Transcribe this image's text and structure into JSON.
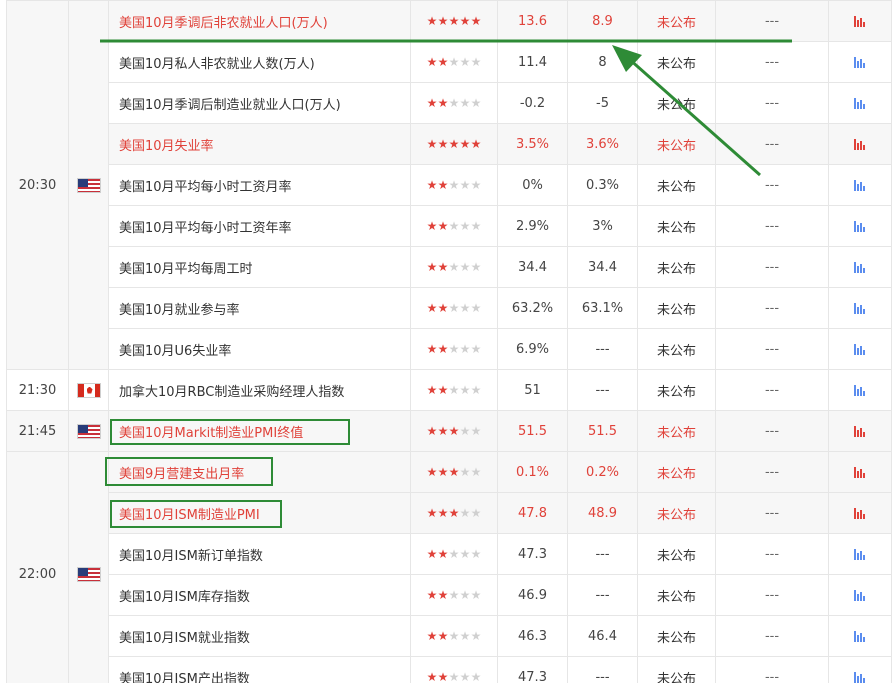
{
  "annotation_color": "#2e8b36",
  "accent_red": "#e0423a",
  "groups": [
    {
      "time": "20:30",
      "flag": "us-flag-icon",
      "rows": [
        {
          "name": "美国10月季调后非农就业人口(万人)",
          "stars": 5,
          "prev": "13.6",
          "forecast": "8.9",
          "actual": "未公布",
          "impact": "---",
          "important": true,
          "chart": "red"
        },
        {
          "name": "美国10月私人非农就业人数(万人)",
          "stars": 2,
          "prev": "11.4",
          "forecast": "8",
          "actual": "未公布",
          "impact": "---",
          "important": false,
          "chart": "blue"
        },
        {
          "name": "美国10月季调后制造业就业人口(万人)",
          "stars": 2,
          "prev": "-0.2",
          "forecast": "-5",
          "actual": "未公布",
          "impact": "---",
          "important": false,
          "chart": "blue"
        },
        {
          "name": "美国10月失业率",
          "stars": 5,
          "prev": "3.5%",
          "forecast": "3.6%",
          "actual": "未公布",
          "impact": "---",
          "important": true,
          "chart": "red"
        },
        {
          "name": "美国10月平均每小时工资月率",
          "stars": 2,
          "prev": "0%",
          "forecast": "0.3%",
          "actual": "未公布",
          "impact": "---",
          "important": false,
          "chart": "blue"
        },
        {
          "name": "美国10月平均每小时工资年率",
          "stars": 2,
          "prev": "2.9%",
          "forecast": "3%",
          "actual": "未公布",
          "impact": "---",
          "important": false,
          "chart": "blue"
        },
        {
          "name": "美国10月平均每周工时",
          "stars": 2,
          "prev": "34.4",
          "forecast": "34.4",
          "actual": "未公布",
          "impact": "---",
          "important": false,
          "chart": "blue"
        },
        {
          "name": "美国10月就业参与率",
          "stars": 2,
          "prev": "63.2%",
          "forecast": "63.1%",
          "actual": "未公布",
          "impact": "---",
          "important": false,
          "chart": "blue"
        },
        {
          "name": "美国10月U6失业率",
          "stars": 2,
          "prev": "6.9%",
          "forecast": "---",
          "actual": "未公布",
          "impact": "---",
          "important": false,
          "chart": "blue"
        }
      ]
    },
    {
      "time": "21:30",
      "flag": "canada-flag-icon",
      "rows": [
        {
          "name": "加拿大10月RBC制造业采购经理人指数",
          "stars": 2,
          "prev": "51",
          "forecast": "---",
          "actual": "未公布",
          "impact": "---",
          "important": false,
          "chart": "blue"
        }
      ]
    },
    {
      "time": "21:45",
      "flag": "us-flag-icon",
      "rows": [
        {
          "name": "美国10月Markit制造业PMI终值",
          "stars": 3,
          "prev": "51.5",
          "forecast": "51.5",
          "actual": "未公布",
          "impact": "---",
          "important": true,
          "chart": "red"
        }
      ]
    },
    {
      "time": "22:00",
      "flag": "us-flag-icon",
      "rows": [
        {
          "name": "美国9月营建支出月率",
          "stars": 3,
          "prev": "0.1%",
          "forecast": "0.2%",
          "actual": "未公布",
          "impact": "---",
          "important": true,
          "chart": "red"
        },
        {
          "name": "美国10月ISM制造业PMI",
          "stars": 3,
          "prev": "47.8",
          "forecast": "48.9",
          "actual": "未公布",
          "impact": "---",
          "important": true,
          "chart": "red"
        },
        {
          "name": "美国10月ISM新订单指数",
          "stars": 2,
          "prev": "47.3",
          "forecast": "---",
          "actual": "未公布",
          "impact": "---",
          "important": false,
          "chart": "blue"
        },
        {
          "name": "美国10月ISM库存指数",
          "stars": 2,
          "prev": "46.9",
          "forecast": "---",
          "actual": "未公布",
          "impact": "---",
          "important": false,
          "chart": "blue"
        },
        {
          "name": "美国10月ISM就业指数",
          "stars": 2,
          "prev": "46.3",
          "forecast": "46.4",
          "actual": "未公布",
          "impact": "---",
          "important": false,
          "chart": "blue"
        },
        {
          "name": "美国10月ISM产出指数",
          "stars": 2,
          "prev": "47.3",
          "forecast": "---",
          "actual": "未公布",
          "impact": "---",
          "important": false,
          "chart": "blue"
        }
      ]
    }
  ]
}
